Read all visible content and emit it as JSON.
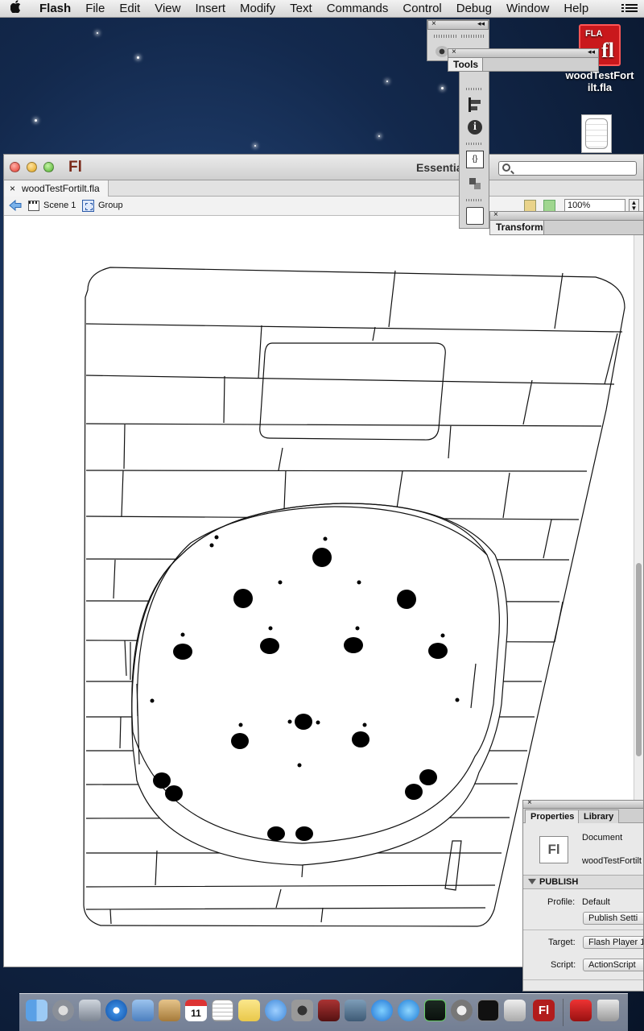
{
  "menubar": {
    "apple": "",
    "items": [
      "Flash",
      "File",
      "Edit",
      "View",
      "Insert",
      "Modify",
      "Text",
      "Commands",
      "Control",
      "Debug",
      "Window",
      "Help"
    ]
  },
  "desktop": {
    "file_badge": "FLA",
    "file_glyph": "fl",
    "file_name_line1": "woodTestFort",
    "file_name_line2": "ilt.fla"
  },
  "window": {
    "app_logo": "Fl",
    "workspace": "Essentia",
    "search_value": "",
    "doc_tab": "woodTestFortilt.fla",
    "doc_tab_close": "×",
    "breadcrumb": {
      "scene": "Scene 1",
      "group": "Group"
    },
    "zoom": "100%"
  },
  "panels": {
    "tools_title": "Tools",
    "transform_title": "Transform",
    "close": "×",
    "collapse": "◂◂",
    "code_icon_text": "{}"
  },
  "properties": {
    "close": "×",
    "tabs": [
      "Properties",
      "Library"
    ],
    "doc_icon": "Fl",
    "doc_type": "Document",
    "doc_name": "woodTestFortilt",
    "publish_header": "PUBLISH",
    "profile_label": "Profile:",
    "profile_value": "Default",
    "publish_settings_button": "Publish Setti",
    "target_label": "Target:",
    "target_value": "Flash Player 1",
    "script_label": "Script:",
    "script_value": "ActionScript"
  },
  "dock": {
    "flash_label": "Fl",
    "calendar_day": "11"
  }
}
